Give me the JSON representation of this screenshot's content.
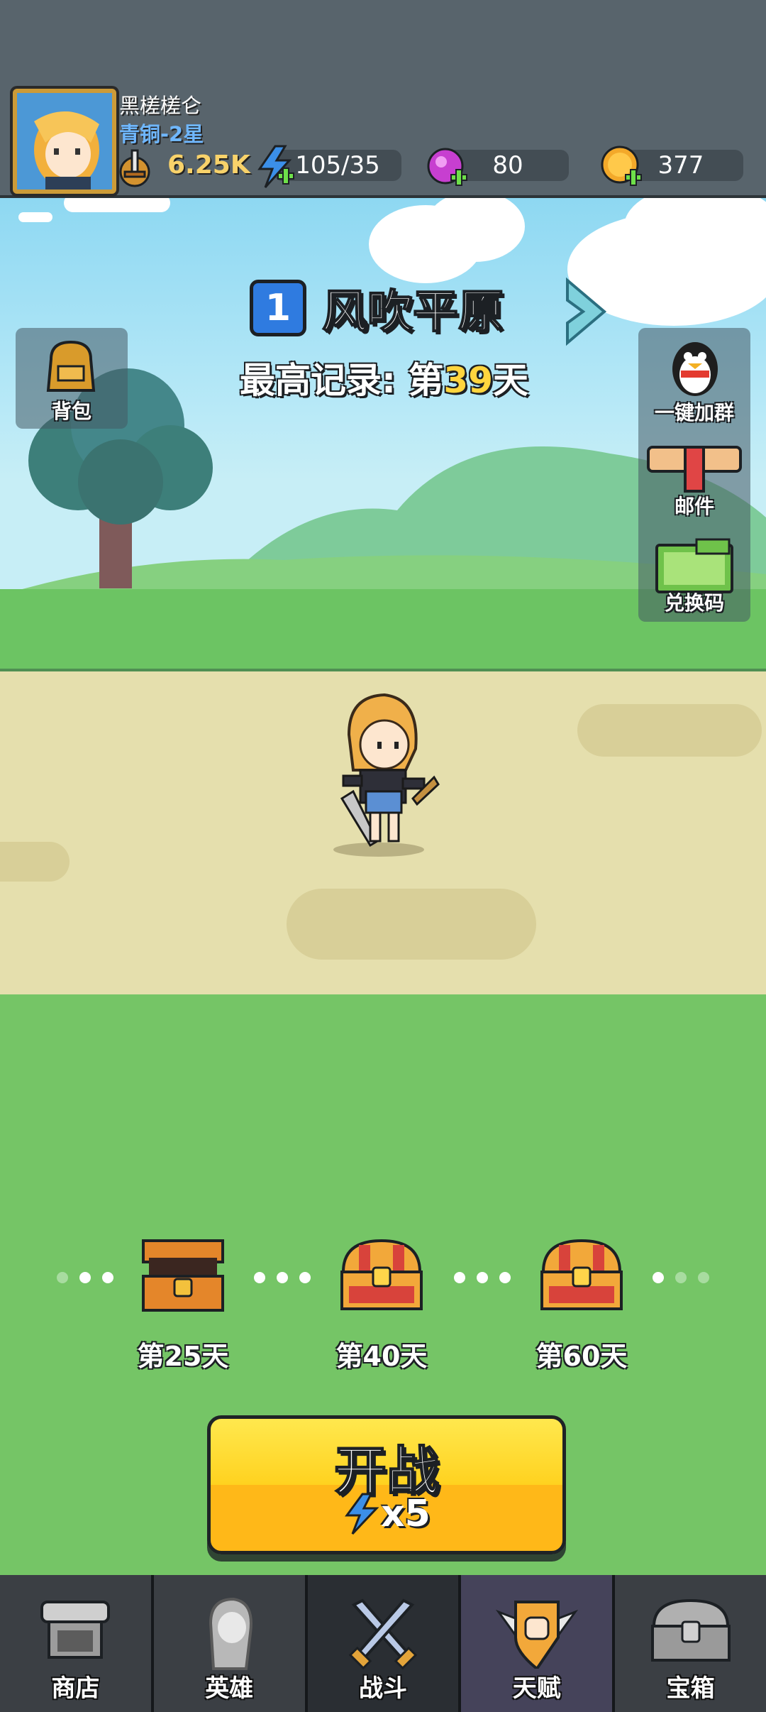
{
  "player": {
    "name": "黑槎槎仑",
    "rank": "青铜-2星",
    "power": "6.25K"
  },
  "resources": [
    {
      "id": "energy",
      "icon": "lightning-plus-icon",
      "value": "105/35"
    },
    {
      "id": "gems",
      "icon": "purple-gem-plus-icon",
      "value": "80"
    },
    {
      "id": "gold",
      "icon": "gold-coin-plus-icon",
      "value": "377"
    }
  ],
  "stage": {
    "number": "1",
    "name": "风吹平原",
    "record_prefix": "最高记录: 第",
    "record_day": "39",
    "record_suffix": "天"
  },
  "side_buttons": {
    "bag": "背包",
    "qq_group": "一键加群",
    "mail": "邮件",
    "redeem": "兑换码"
  },
  "milestones": [
    {
      "label": "第25天",
      "state": "opened"
    },
    {
      "label": "第40天",
      "state": "closed"
    },
    {
      "label": "第60天",
      "state": "closed"
    }
  ],
  "start": {
    "label": "开战",
    "cost": "x5"
  },
  "nav": [
    {
      "id": "shop",
      "label": "商店"
    },
    {
      "id": "heroes",
      "label": "英雄"
    },
    {
      "id": "battle",
      "label": "战斗"
    },
    {
      "id": "talent",
      "label": "天赋"
    },
    {
      "id": "chest",
      "label": "宝箱"
    }
  ],
  "colors": {
    "accent_yellow": "#ffd21f",
    "record_highlight": "#ffd53e",
    "rank_blue": "#6fb7ff",
    "grass": "#75c566",
    "path": "#e5dfad"
  }
}
